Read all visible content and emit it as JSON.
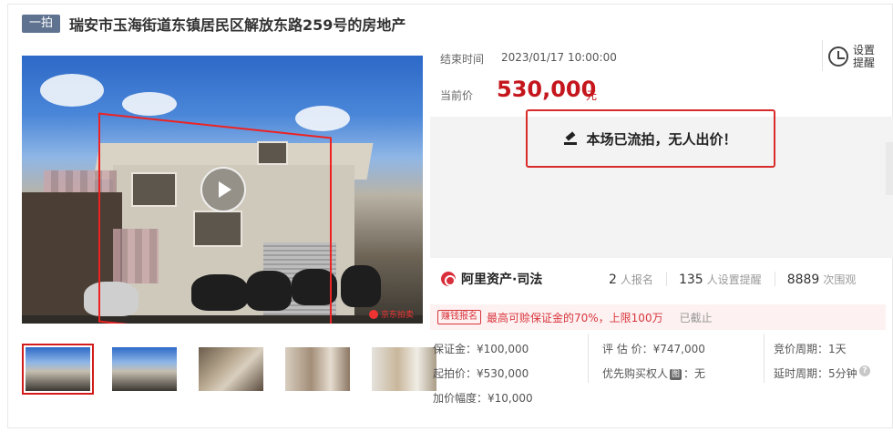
{
  "header": {
    "tag": "一拍",
    "title": "瑞安市玉海街道东镇居民区解放东路259号的房地产"
  },
  "auction": {
    "end_label": "结束时间",
    "end_time": "2023/01/17 10:00:00",
    "price_label": "当前价",
    "price": "530,000",
    "price_unit": "元",
    "remind_label": "设置提醒",
    "status_text": "本场已流拍，无人出价！"
  },
  "stats": {
    "brand": "阿里资产·司法",
    "signups_num": "2",
    "signups_label": "人报名",
    "reminders_num": "135",
    "reminders_label": "人设置提醒",
    "views_num": "8889",
    "views_label": "次围观"
  },
  "promo": {
    "tag": "赚钱报名",
    "text": "最高可赊保证金的70%，上限100万",
    "status": "已截止"
  },
  "details": {
    "deposit": "保证金：¥100,000",
    "appraisal": "评 估 价：¥747,000",
    "bid_cycle": "竞价周期：1天",
    "start_price": "起拍价：¥530,000",
    "priority_label": "优先购买权人",
    "priority_badge": "图",
    "priority_value": "：无",
    "delay_cycle": "延时周期：5分钟",
    "increment": "加价幅度：¥10,000"
  },
  "photo": {
    "watermark": "京东拍卖"
  },
  "icons": {
    "remind": "alarm-clock-icon",
    "status": "gavel-icon",
    "play": "play-icon",
    "help": "help-circle-icon"
  },
  "colors": {
    "accent_red": "#c4161c",
    "tag_bg": "#5f7290",
    "status_border": "#d92b2b"
  }
}
